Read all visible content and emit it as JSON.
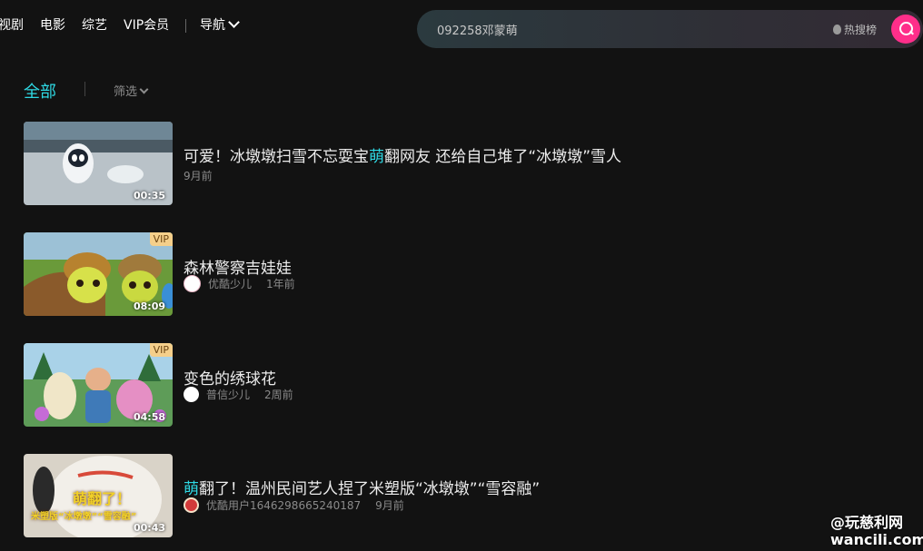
{
  "nav": {
    "links": [
      "视剧",
      "电影",
      "综艺",
      "VIP会员"
    ],
    "guide": "导航"
  },
  "search": {
    "query": "092258邓蒙萌",
    "hot_label": "热搜榜",
    "button_icon": "search-icon"
  },
  "filter": {
    "active_tab": "全部",
    "filter_label": "筛选"
  },
  "colors": {
    "accent": "#2ed8e3",
    "search_button": "#ff2e8a",
    "vip_badge": "#f5cf8a",
    "background": "#121212"
  },
  "results": [
    {
      "title_before": "可爱！冰墩墩扫雪不忘耍宝",
      "title_highlight": "萌",
      "title_after": "翻网友 还给自己堆了“冰墩墩”雪人",
      "channel": "",
      "time": "9月前",
      "duration": "00:35",
      "vip": ""
    },
    {
      "title_before": "森林警察吉娃娃",
      "title_highlight": "",
      "title_after": "",
      "channel": "优酷少儿",
      "time": "1年前",
      "duration": "08:09",
      "vip": "VIP"
    },
    {
      "title_before": "变色的绣球花",
      "title_highlight": "",
      "title_after": "",
      "channel": "普信少儿",
      "time": "2周前",
      "duration": "04:58",
      "vip": "VIP"
    },
    {
      "title_before": "",
      "title_highlight": "萌",
      "title_after": "翻了！温州民间艺人捏了米塑版“冰墩墩”“雪容融”",
      "channel": "优酷用户1646298665240187",
      "time": "9月前",
      "duration": "00:43",
      "vip": "",
      "thumb_caption_1": "萌翻了！",
      "thumb_caption_2": "米塑版“冰墩墩”“雪容融”"
    }
  ],
  "watermark": {
    "line1": "@玩慈利网",
    "line2": "wancili.com"
  }
}
